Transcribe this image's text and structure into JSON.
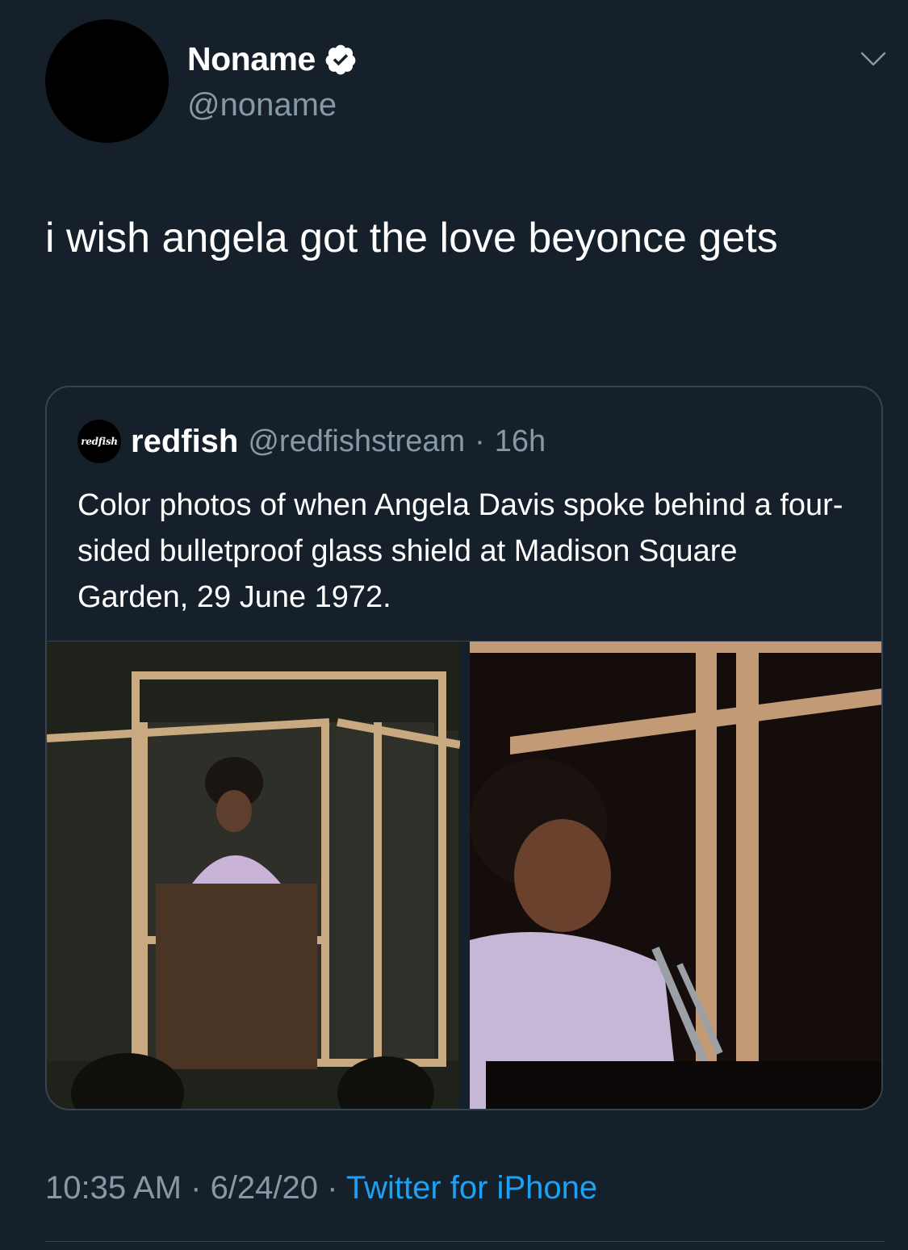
{
  "author": {
    "display_name": "Noname",
    "handle": "@noname",
    "verified": true
  },
  "tweet": {
    "text": "i wish angela got the love beyonce gets"
  },
  "quoted_tweet": {
    "avatar_text": "redfish",
    "display_name": "redfish",
    "handle": "@redfishstream",
    "separator": "·",
    "time": "16h",
    "text": "Color photos of when Angela Davis spoke behind a four-sided bulletproof glass shield at Madison Square Garden, 29 June 1972."
  },
  "footer": {
    "time": "10:35 AM",
    "sep1": " · ",
    "date": "6/24/20",
    "sep2": " · ",
    "source": "Twitter for iPhone"
  },
  "colors": {
    "background": "#15202b",
    "secondary_text": "#8899a6",
    "link": "#1da1f2",
    "border": "#38444d"
  },
  "icons": {
    "verified": "verified-badge-icon",
    "menu": "chevron-down-icon"
  }
}
